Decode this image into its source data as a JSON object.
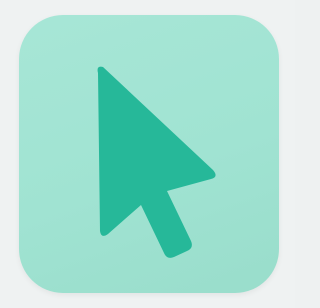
{
  "icon": {
    "name": "cursor-arrow-icon",
    "tile_color": "#a3e4d3",
    "cursor_color": "#26b899"
  }
}
